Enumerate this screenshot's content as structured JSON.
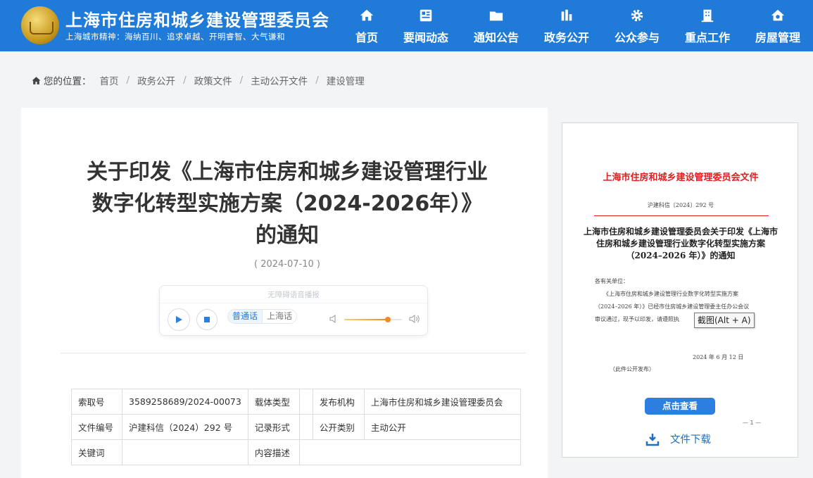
{
  "header": {
    "site_title": "上海市住房和城乡建设管理委员会",
    "motto": "上海城市精神：海纳百川、追求卓越、开明睿智、大气谦和",
    "nav": [
      {
        "label": "首页",
        "icon": "home-icon"
      },
      {
        "label": "要闻动态",
        "icon": "newspaper-icon"
      },
      {
        "label": "通知公告",
        "icon": "folder-icon"
      },
      {
        "label": "政务公开",
        "icon": "bar-chart-icon"
      },
      {
        "label": "公众参与",
        "icon": "gear-icon"
      },
      {
        "label": "重点工作",
        "icon": "building-icon"
      },
      {
        "label": "房屋管理",
        "icon": "house-icon"
      }
    ],
    "colors": {
      "header_bg": "#1f7ad8"
    }
  },
  "breadcrumb": {
    "prefix": "您的位置：",
    "items": [
      "首页",
      "政务公开",
      "政策文件",
      "主动公开文件",
      "建设管理"
    ]
  },
  "article": {
    "title": "关于印发《上海市住房和城乡建设管理行业数字化转型实施方案（2024-2026年）》的通知",
    "date": "( 2024-07-10 )"
  },
  "player": {
    "title": "无障碍语音播报",
    "lang_selected": "普通话",
    "lang_other": "上海话",
    "volume": 0.75
  },
  "info_table": {
    "rows": [
      [
        "索取号",
        "3589258689/2024-00073",
        "载体类型",
        "",
        "发布机构",
        "上海市住房和城乡建设管理委员会"
      ],
      [
        "文件编号",
        "沪建科信（2024）292 号",
        "记录形式",
        "",
        "公开类别",
        "主动公开"
      ],
      [
        "关键词",
        "",
        "内容描述",
        "",
        "",
        ""
      ]
    ]
  },
  "preview": {
    "doc_header": "上海市住房和城乡建设管理委员会文件",
    "doc_number": "沪建科信〔2024〕292 号",
    "doc_title": "上海市住房和城乡建设管理委员会关于印发《上海市住房和城乡建设管理行业数字化转型实施方案（2024–2026 年）》的通知",
    "body_lines": [
      "各有关单位：",
      "　　《上海市住房和城乡建设管理行业数字化转型实施方案",
      "（2024–2026 年）》已经市住房城乡建设管理委主任办公会议",
      "审议通过，现予以印发，请遵照执"
    ],
    "doc_date": "2024 年 6 月 12 日",
    "doc_note": "（此件公开发布）",
    "page_mark": "— 1 —",
    "tooltip": "截图(Alt + A)",
    "view_button": "点击查看",
    "download_label": "文件下载"
  }
}
